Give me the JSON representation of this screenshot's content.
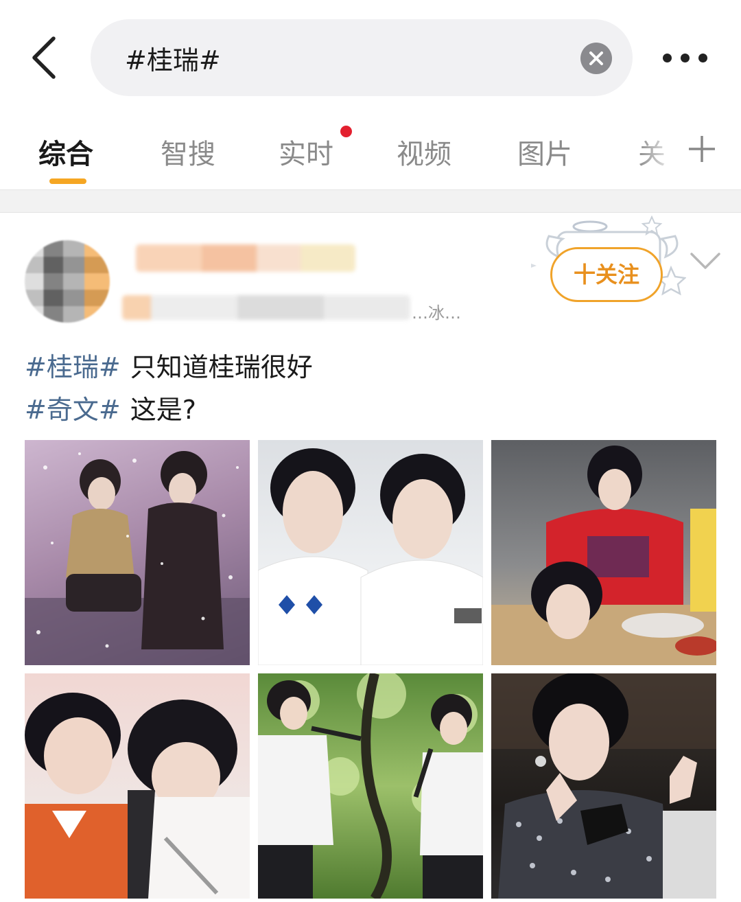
{
  "search": {
    "query": "#桂瑞#"
  },
  "tabs": [
    {
      "label": "综合",
      "active": true
    },
    {
      "label": "智搜"
    },
    {
      "label": "实时",
      "badge": "red-dot"
    },
    {
      "label": "视频"
    },
    {
      "label": "图片"
    },
    {
      "label": "关"
    }
  ],
  "post": {
    "meta_tail": "…冰…",
    "follow_label": "十关注",
    "line1": {
      "tag": "#桂瑞#",
      "text": "只知道桂瑞很好"
    },
    "line2": {
      "tag": "#奇文#",
      "text": "这是?"
    },
    "images": [
      {
        "name": "photo-1",
        "desc": "two performers seated on stage with falling snow"
      },
      {
        "name": "photo-2",
        "desc": "two boys in white t-shirts"
      },
      {
        "name": "photo-3",
        "desc": "boy in red hoodie at table"
      },
      {
        "name": "photo-4",
        "desc": "two boys laughing in orange jersey"
      },
      {
        "name": "photo-5",
        "desc": "two boys singing outdoors under trees"
      },
      {
        "name": "photo-6",
        "desc": "boy in studded jacket making hand gesture"
      }
    ]
  },
  "colors": {
    "accent": "#f5a623",
    "tag_blue": "#4a6a8f",
    "badge_red": "#e3202f"
  }
}
